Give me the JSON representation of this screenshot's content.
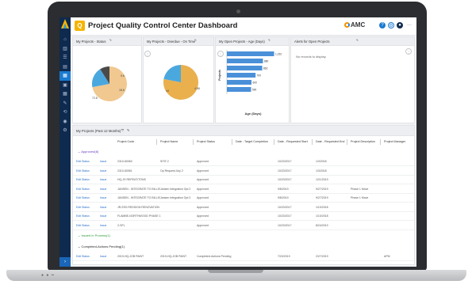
{
  "app": {
    "title": "Project Quality Control Center Dashboard",
    "badge": "Q",
    "brand": "AMC",
    "accent": "#1a7bd0"
  },
  "header_icons": [
    "help-icon",
    "settings-icon",
    "user-icon",
    "more-icon"
  ],
  "sidebar": {
    "icons": [
      "home-icon",
      "chart-icon",
      "list-icon",
      "document-icon",
      "dashboard-icon",
      "report-icon",
      "calendar-icon",
      "tools-icon",
      "link-icon",
      "location-icon",
      "settings-icon"
    ],
    "active_index": 4
  },
  "widgets": {
    "status": {
      "title": "My Projects - Status"
    },
    "overdue": {
      "title": "My Projects - Overdue - On Time"
    },
    "open_age": {
      "title": "My Open Projects - Age (Days)",
      "ylabel": "Projects",
      "xlabel": "Age (Days)"
    },
    "alerts": {
      "title": "Alerts for Open Projects",
      "empty_text": "No records to display."
    }
  },
  "chart_data": [
    {
      "type": "pie",
      "title": "My Projects - Status",
      "values": [
        72,
        19,
        9
      ],
      "colors": [
        "#f0c890",
        "#4ba8de",
        "#4a4a4a"
      ]
    },
    {
      "type": "pie",
      "title": "My Projects - Overdue - On Time",
      "values": [
        78,
        22
      ],
      "colors": [
        "#e9b04d",
        "#4ba8de"
      ]
    },
    {
      "type": "bar",
      "orientation": "horizontal",
      "title": "My Open Projects - Age (Days)",
      "xlabel": "Age (Days)",
      "ylabel": "Projects",
      "values": [
        1152,
        880,
        862,
        700,
        600,
        590
      ],
      "data_labels": [
        "1,152",
        "880",
        "862",
        "700",
        "600",
        "590"
      ],
      "xlim": [
        0,
        1200
      ],
      "color": "#4a90d9"
    }
  ],
  "list": {
    "title": "My Projects (Past 12 Months)",
    "columns": [
      "Project Code",
      "Project Name",
      "Project Status",
      "Date - Target Completion",
      "Date - Requested Start",
      "Date - Requested End",
      "Project Description",
      "Project Manager"
    ],
    "groups": [
      {
        "label": "Approved(8)",
        "color": "#6a3dbf",
        "rows": [
          [
            "Edit Status",
            "Issue",
            "2310-60060",
            "SITE 2",
            "Approved",
            "",
            "10/23/2017",
            "1/3/2018",
            "",
            ""
          ],
          [
            "Edit Status",
            "Issue",
            "2310-60061",
            "Op Request July 2",
            "Approved",
            "",
            "10/23/2017",
            "1/3/2018",
            "",
            ""
          ],
          [
            "Edit Status",
            "Issue",
            "HQ-JS REPEAT/TONS",
            "",
            "Approved",
            "",
            "10/23/2017",
            "12/1/2019",
            "",
            ""
          ],
          [
            "Edit Status",
            "Issue",
            "JANSEN - INTEGRATE TO BILLIS",
            "Jansen Integration Opt 2",
            "Approved",
            "",
            "9/8/2019",
            "9/27/2019",
            "Phase 1 Move",
            ""
          ],
          [
            "Edit Status",
            "Issue",
            "JANSEN - INTEGRATE TO BILLIS",
            "Jansen Integration Opt 2",
            "Approved",
            "",
            "9/8/2019",
            "9/27/2019",
            "Phase 1 Move",
            ""
          ],
          [
            "Edit Status",
            "Issue",
            "JR-ESS REDSIGN RENOVATION",
            "",
            "Approved",
            "",
            "10/23/2017",
            "1/10/2018",
            "",
            ""
          ],
          [
            "Edit Status",
            "Issue",
            "FLAMBE-NORTHWOOD PHASE 1",
            "",
            "Approved",
            "",
            "10/23/2017",
            "1/10/2018",
            "",
            ""
          ],
          [
            "Edit Status",
            "Issue",
            "2-SFL",
            "",
            "Approved",
            "",
            "10/23/2017",
            "8/24/2019",
            "",
            ""
          ]
        ]
      },
      {
        "label": "Issued in Process(1)",
        "color": "#2e9e3a",
        "rows": []
      },
      {
        "label": "Completed-Actions Pending(1)",
        "color": "#222222",
        "rows": [
          [
            "Edit Status",
            "Issue",
            "2019-HQ-JOB PAINT",
            "2019-HQ-JOB PAINT",
            "Completed-Actions Pending",
            "",
            "7/20/2019",
            "2/27/2019",
            "",
            "APM"
          ]
        ]
      }
    ]
  }
}
